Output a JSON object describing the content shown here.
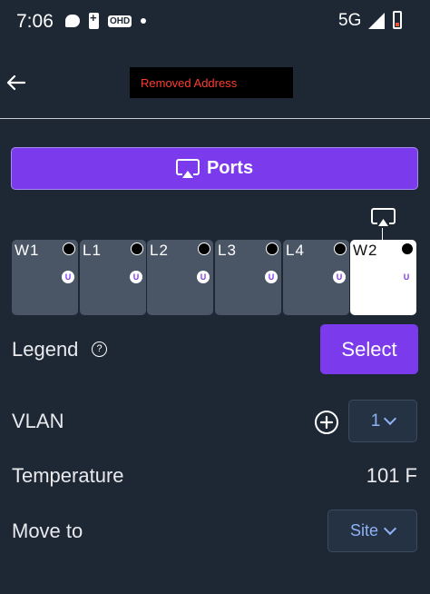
{
  "status_bar": {
    "time": "7:06",
    "ohd": "OHD",
    "network": "5G"
  },
  "header": {
    "address": "Removed Address"
  },
  "ports_button": {
    "label": "Ports"
  },
  "ports": [
    {
      "label": "W1",
      "tag": "U"
    },
    {
      "label": "L1",
      "tag": "U"
    },
    {
      "label": "L2",
      "tag": "U"
    },
    {
      "label": "L3",
      "tag": "U"
    },
    {
      "label": "L4",
      "tag": "U"
    },
    {
      "label": "W2",
      "tag": "U"
    }
  ],
  "legend": {
    "label": "Legend",
    "help_glyph": "?",
    "select_label": "Select"
  },
  "vlan": {
    "label": "VLAN",
    "value": "1"
  },
  "temperature": {
    "label": "Temperature",
    "value": "101 F"
  },
  "move_to": {
    "label": "Move to",
    "value": "Site"
  },
  "colors": {
    "background": "#1e2734",
    "accent": "#7c3aed",
    "tile": "#4a5666",
    "dropdown_text": "#8fb2f5"
  }
}
